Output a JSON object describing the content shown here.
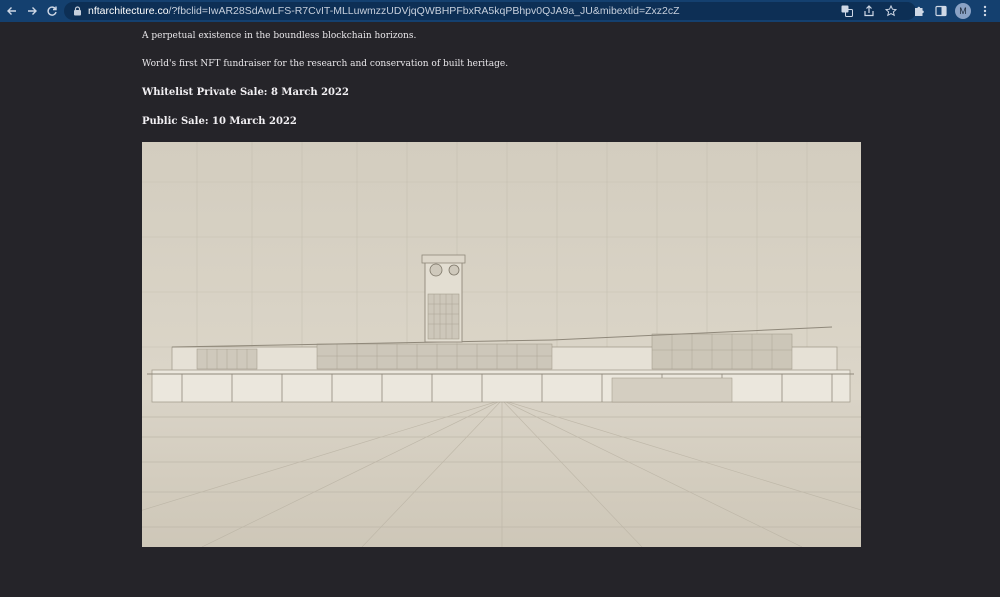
{
  "browser": {
    "url_host": "nftarchitecture.co",
    "url_rest": "/?fbclid=IwAR28SdAwLFS-R7CvIT-MLLuwmzzUDVjqQWBHPFbxRA5kqPBhpv0QJA9a_JU&mibextid=Zxz2cZ",
    "profile_initial": "M"
  },
  "page": {
    "tagline": "A perpetual existence in the boundless blockchain horizons.",
    "description": "World's first NFT fundraiser for the research and conservation of built heritage.",
    "whitelist_sale": "Whitelist Private Sale: 8 March 2022",
    "public_sale": "Public Sale: 10 March 2022"
  },
  "colors": {
    "page_bg": "#252429",
    "toolbar_bg": "#14406f",
    "render_bg": "#d8d2c4"
  }
}
